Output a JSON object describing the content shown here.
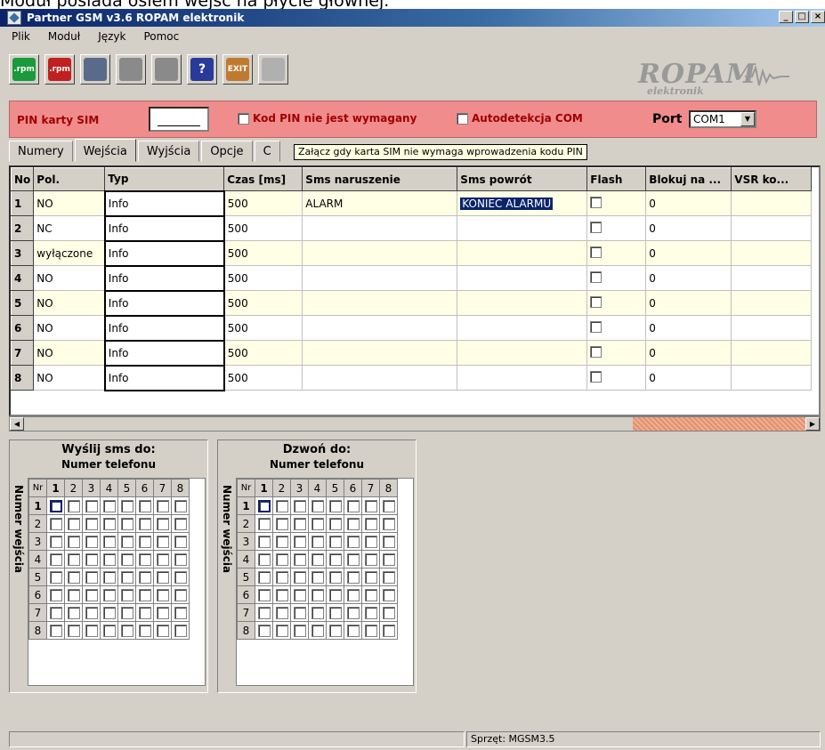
{
  "doc_text": "Moduł posiada osiem wejść na płycie głównej.",
  "window": {
    "title": "Partner GSM v3.6 ROPAM elektronik",
    "btn_min": "_",
    "btn_max": "□",
    "btn_close": "×"
  },
  "menu": [
    "Plik",
    "Moduł",
    "Język",
    "Pomoc"
  ],
  "toolbar": [
    {
      "name": "upload-rpm",
      "label": ".rpm",
      "color": "#1a9a3a"
    },
    {
      "name": "download-rpm",
      "label": ".rpm",
      "color": "#c02020"
    },
    {
      "name": "read-module",
      "label": "",
      "color": "#5a6a8a"
    },
    {
      "name": "write-module",
      "label": "",
      "color": "#8a8a8a"
    },
    {
      "name": "write-module-2",
      "label": "",
      "color": "#8a8a8a"
    },
    {
      "name": "help",
      "label": "?",
      "color": "#2a3a9a"
    },
    {
      "name": "exit",
      "label": "EXIT",
      "color": "#c07a30"
    },
    {
      "name": "gsm-signal",
      "label": "",
      "color": "#b0b0b0"
    }
  ],
  "logo": {
    "text": "ROPAM",
    "sub": "elektronik"
  },
  "pin": {
    "label": "PIN karty SIM",
    "not_required": "Kod PIN nie jest wymagany",
    "autodetect": "Autodetekcja COM",
    "port_label": "Port",
    "port_value": "COM1"
  },
  "tabs": [
    "Numery",
    "Wejścia",
    "Wyjścia",
    "Opcje",
    "C"
  ],
  "tooltip": "Załącz gdy karta SIM nie wymaga wprowadzenia kodu PIN",
  "grid": {
    "headers": [
      "No",
      "Pol.",
      "Typ",
      "Czas [ms]",
      "Sms naruszenie",
      "Sms powrót",
      "Flash",
      "Blokuj na ...",
      "VSR ko..."
    ],
    "rows": [
      {
        "no": "1",
        "pol": "NO",
        "typ": "Info",
        "czas": "500",
        "sms_n": "ALARM",
        "sms_p": "KONIEC ALARMU",
        "blok": "0"
      },
      {
        "no": "2",
        "pol": "NC",
        "typ": "Info",
        "czas": "500",
        "sms_n": "",
        "sms_p": "",
        "blok": "0"
      },
      {
        "no": "3",
        "pol": "wyłączone",
        "typ": "Info",
        "czas": "500",
        "sms_n": "",
        "sms_p": "",
        "blok": "0"
      },
      {
        "no": "4",
        "pol": "NO",
        "typ": "Info",
        "czas": "500",
        "sms_n": "",
        "sms_p": "",
        "blok": "0"
      },
      {
        "no": "5",
        "pol": "NO",
        "typ": "Info",
        "czas": "500",
        "sms_n": "",
        "sms_p": "",
        "blok": "0"
      },
      {
        "no": "6",
        "pol": "NO",
        "typ": "Info",
        "czas": "500",
        "sms_n": "",
        "sms_p": "",
        "blok": "0"
      },
      {
        "no": "7",
        "pol": "NO",
        "typ": "Info",
        "czas": "500",
        "sms_n": "",
        "sms_p": "",
        "blok": "0"
      },
      {
        "no": "8",
        "pol": "NO",
        "typ": "Info",
        "czas": "500",
        "sms_n": "",
        "sms_p": "",
        "blok": "0"
      }
    ]
  },
  "sms_panel": {
    "title": "Wyślij sms do:",
    "sub": "Numer telefonu",
    "vlabel": "Numer wejścia",
    "corner": "Nr"
  },
  "call_panel": {
    "title": "Dzwoń do:",
    "sub": "Numer telefonu",
    "vlabel": "Numer wejścia",
    "corner": "Nr"
  },
  "matrix_cols": [
    "1",
    "2",
    "3",
    "4",
    "5",
    "6",
    "7",
    "8"
  ],
  "matrix_rows": [
    "1",
    "2",
    "3",
    "4",
    "5",
    "6",
    "7",
    "8"
  ],
  "status": {
    "left": "",
    "right": "Sprzęt: MGSM3.5"
  }
}
